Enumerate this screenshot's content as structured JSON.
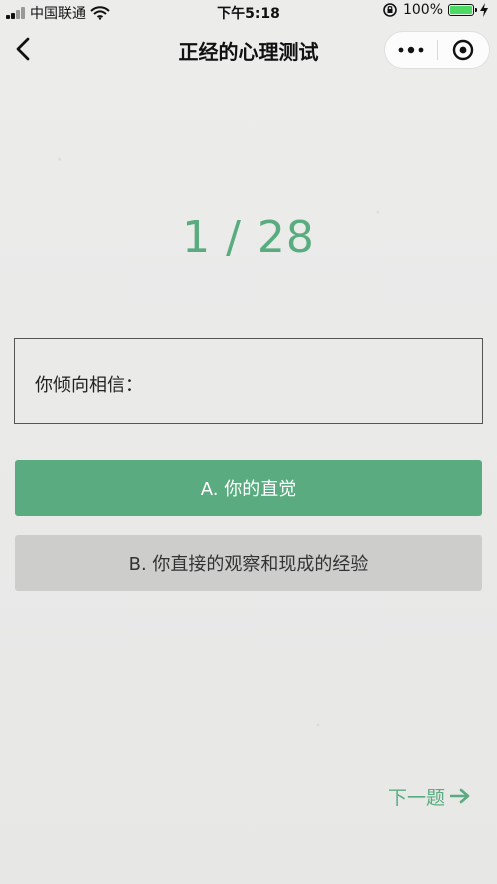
{
  "status_bar": {
    "carrier": "中国联通",
    "time": "下午5:18",
    "battery_percent": "100%",
    "signal_level": 0.5,
    "battery_level": 1.0
  },
  "nav": {
    "title": "正经的心理测试"
  },
  "quiz": {
    "progress": "1 / 28",
    "question": "你倾向相信：",
    "options": [
      {
        "label": "A. 你的直觉"
      },
      {
        "label": "B. 你直接的观察和现成的经验"
      }
    ],
    "next_label": "下一题"
  },
  "icons": {
    "back": "chevron-left-icon",
    "more": "more-dots-icon",
    "close": "target-close-icon",
    "wifi": "wifi-icon",
    "orientation_lock": "orientation-lock-icon",
    "battery": "battery-icon",
    "charging": "charging-bolt-icon",
    "next": "arrow-right-icon"
  },
  "colors": {
    "accent": "#5aac80",
    "option_b_background": "#cdcdcc",
    "text_primary": "#111111"
  }
}
